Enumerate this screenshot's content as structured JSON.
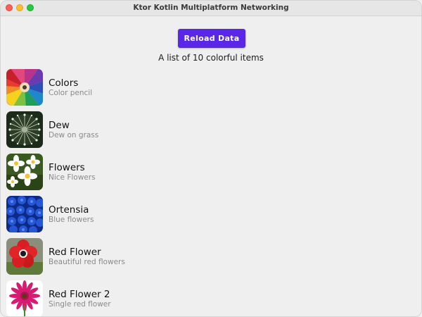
{
  "window": {
    "title": "Ktor Kotlin Multiplatform Networking"
  },
  "toolbar": {
    "reload_label": "Reload Data"
  },
  "summary": {
    "text": "A list of 10 colorful items"
  },
  "items": [
    {
      "title": "Colors",
      "subtitle": "Color pencil",
      "icon": "color-pencils-image"
    },
    {
      "title": "Dew",
      "subtitle": "Dew on grass",
      "icon": "dew-dandelion-image"
    },
    {
      "title": "Flowers",
      "subtitle": "Nice Flowers",
      "icon": "white-flowers-image"
    },
    {
      "title": "Ortensia",
      "subtitle": "Blue flowers",
      "icon": "blue-hydrangea-image"
    },
    {
      "title": "Red Flower",
      "subtitle": "Beautiful red flowers",
      "icon": "red-anemone-image"
    },
    {
      "title": "Red Flower 2",
      "subtitle": "Single red flower",
      "icon": "pink-gerbera-image"
    }
  ],
  "colors": {
    "accent": "#5a26e8",
    "close": "#fe5f57",
    "minimize": "#febc2e",
    "maximize": "#28c840"
  }
}
